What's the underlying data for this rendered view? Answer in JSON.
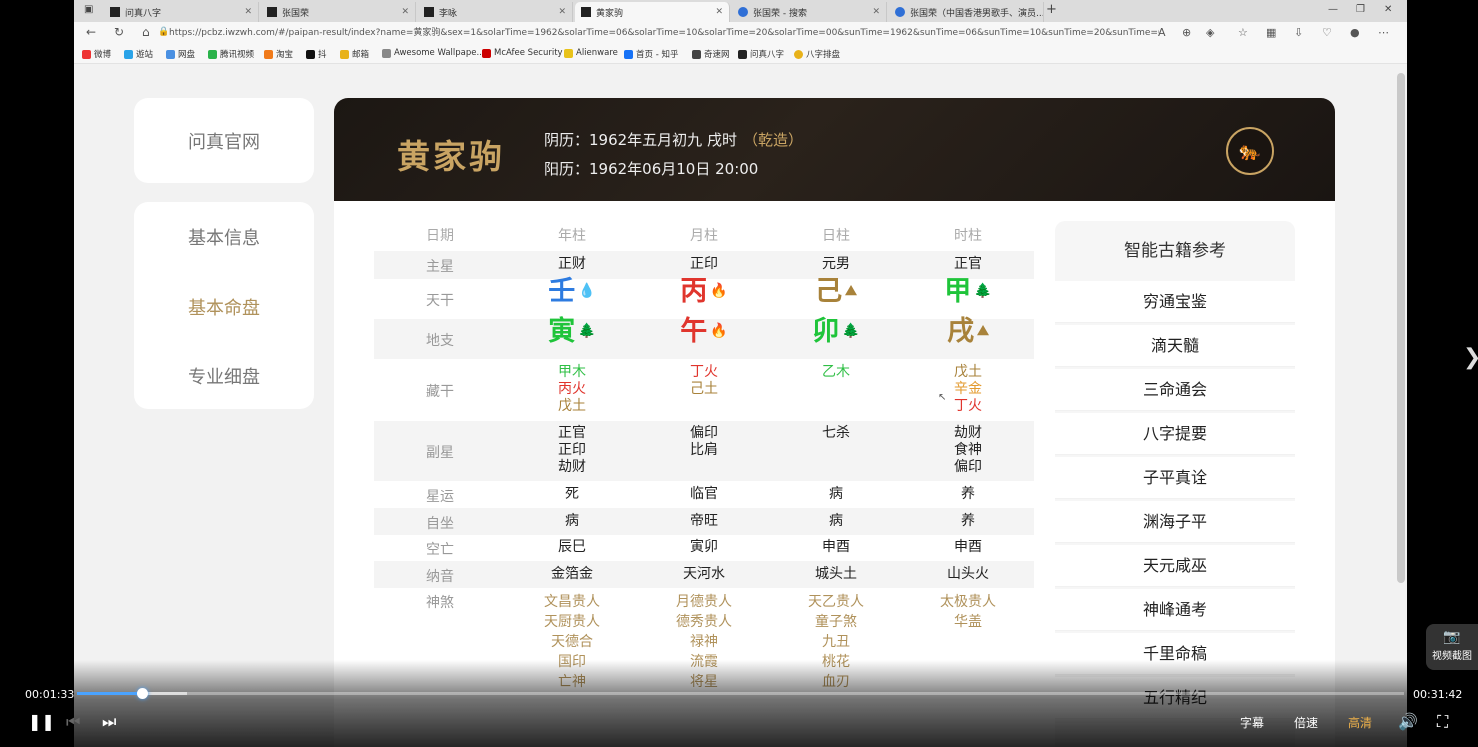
{
  "browser": {
    "tabs": [
      {
        "label": "问真八字",
        "active": false
      },
      {
        "label": "张国荣",
        "active": false
      },
      {
        "label": "李咏",
        "active": false
      },
      {
        "label": "黄家驹",
        "active": true
      },
      {
        "label": "张国荣 - 搜索",
        "active": false
      },
      {
        "label": "张国荣（中国香港男歌手、演员...",
        "active": false
      }
    ],
    "new_tab": "+",
    "url": "https://pcbz.iwzwh.com/#/paipan-result/index?name=黄家驹&sex=1&solarTime=1962&solarTime=06&solarTime=10&solarTime=20&solarTime=00&sunTime=1962&sunTime=06&sunTime=10&sunTime=20&sunTime=00&MRType=0...",
    "bookmarks": [
      "微博",
      "遊站",
      "网盘",
      "腾讯视频",
      "淘宝",
      "抖",
      "邮箱",
      "Awesome Wallpape...",
      "McAfee Security",
      "Alienware",
      "首页 - 知乎",
      "奇速网",
      "问真八字",
      "八字排盘"
    ]
  },
  "sidebar": {
    "home": "问真官网",
    "items": [
      {
        "label": "基本信息",
        "active": false
      },
      {
        "label": "基本命盘",
        "active": true
      },
      {
        "label": "专业细盘",
        "active": false
      }
    ]
  },
  "header": {
    "name": "黄家驹",
    "lunar": "阴历：1962年五月初九 戌时",
    "gender_tag": "（乾造）",
    "solar": "阳历：1962年06月10日 20:00"
  },
  "chart": {
    "columns": [
      "日期",
      "年柱",
      "月柱",
      "日柱",
      "时柱"
    ],
    "main_star": {
      "label": "主星",
      "values": [
        "正财",
        "正印",
        "元男",
        "正官"
      ]
    },
    "tiangan": {
      "label": "天干",
      "values": [
        {
          "char": "壬",
          "color": "#2d7be0",
          "icon": "water-drop-icon"
        },
        {
          "char": "丙",
          "color": "#e0352d",
          "icon": "fire-icon"
        },
        {
          "char": "己",
          "color": "#a8823a",
          "icon": "earth-icon"
        },
        {
          "char": "甲",
          "color": "#1fc43a",
          "icon": "wood-icon"
        }
      ]
    },
    "dizhi": {
      "label": "地支",
      "values": [
        {
          "char": "寅",
          "color": "#1fc43a",
          "icon": "wood-icon"
        },
        {
          "char": "午",
          "color": "#e0352d",
          "icon": "fire-icon"
        },
        {
          "char": "卯",
          "color": "#1fc43a",
          "icon": "wood-icon"
        },
        {
          "char": "戌",
          "color": "#a8823a",
          "icon": "earth-icon"
        }
      ]
    },
    "canggan": {
      "label": "藏干",
      "values": [
        [
          {
            "t": "甲木",
            "c": "#2fbf45"
          },
          {
            "t": "丙火",
            "c": "#e0352d"
          },
          {
            "t": "戊土",
            "c": "#a8823a"
          }
        ],
        [
          {
            "t": "丁火",
            "c": "#e0352d"
          },
          {
            "t": "己土",
            "c": "#a8823a"
          }
        ],
        [
          {
            "t": "乙木",
            "c": "#2fbf45"
          }
        ],
        [
          {
            "t": "戊土",
            "c": "#a8823a"
          },
          {
            "t": "辛金",
            "c": "#e39a2e"
          },
          {
            "t": "丁火",
            "c": "#e0352d"
          }
        ]
      ]
    },
    "fuxing": {
      "label": "副星",
      "values": [
        [
          "正官",
          "正印",
          "劫财"
        ],
        [
          "偏印",
          "比肩"
        ],
        [
          "七杀"
        ],
        [
          "劫财",
          "食神",
          "偏印"
        ]
      ]
    },
    "xingyun": {
      "label": "星运",
      "values": [
        "死",
        "临官",
        "病",
        "养"
      ]
    },
    "zizuo": {
      "label": "自坐",
      "values": [
        "病",
        "帝旺",
        "病",
        "养"
      ]
    },
    "kongwang": {
      "label": "空亡",
      "values": [
        "辰巳",
        "寅卯",
        "申酉",
        "申酉"
      ]
    },
    "nayin": {
      "label": "纳音",
      "values": [
        "金箔金",
        "天河水",
        "城头土",
        "山头火"
      ]
    },
    "shensha": {
      "label": "神煞",
      "values": [
        [
          "文昌贵人",
          "天厨贵人",
          "天德合",
          "国印",
          "亡神"
        ],
        [
          "月德贵人",
          "德秀贵人",
          "禄神",
          "流霞",
          "将星"
        ],
        [
          "天乙贵人",
          "童子煞",
          "九丑",
          "桃花",
          "血刃"
        ],
        [
          "太极贵人",
          "华盖"
        ]
      ]
    }
  },
  "books": {
    "title": "智能古籍参考",
    "items": [
      "穷通宝鉴",
      "滴天髓",
      "三命通会",
      "八字提要",
      "子平真诠",
      "渊海子平",
      "天元咸巫",
      "神峰通考",
      "千里命稿",
      "五行精纪"
    ]
  },
  "player": {
    "current_time": "00:01:33",
    "duration": "00:31:42",
    "played_fraction": 0.049,
    "buffered_fraction": 0.083,
    "subtitle_label": "字幕",
    "speed_label": "倍速",
    "quality_label": "高清",
    "screenshot_label": "视频截图"
  }
}
